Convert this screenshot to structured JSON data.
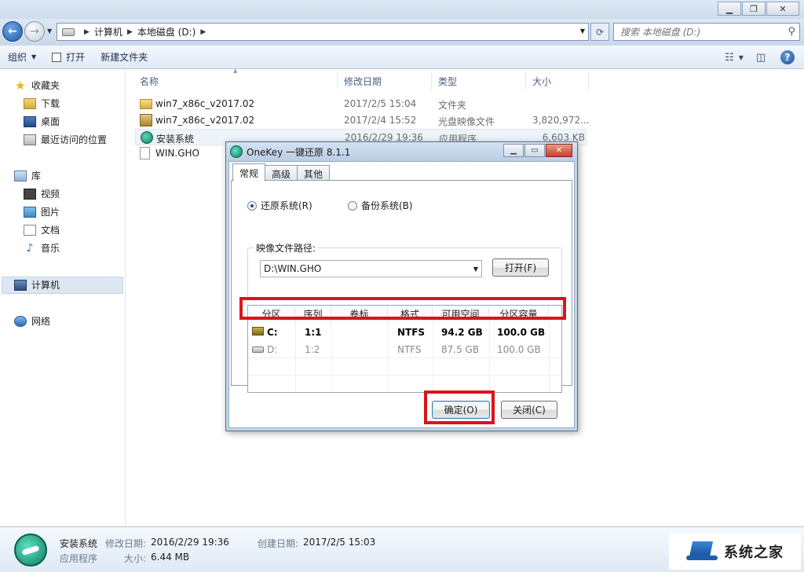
{
  "window": {
    "minimize": "▁",
    "maximize": "❐",
    "close": "✕"
  },
  "address": {
    "crumbs": [
      "计算机",
      "本地磁盘 (D:)"
    ],
    "search_placeholder": "搜索 本地磁盘 (D:)"
  },
  "toolbar": {
    "organize": "组织",
    "open": "打开",
    "new_folder": "新建文件夹"
  },
  "nav": {
    "favorites": "收藏夹",
    "downloads": "下载",
    "desktop": "桌面",
    "recent": "最近访问的位置",
    "libraries": "库",
    "videos": "视频",
    "pictures": "图片",
    "documents": "文档",
    "music": "音乐",
    "computer": "计算机",
    "network": "网络"
  },
  "columns": {
    "name": "名称",
    "modified": "修改日期",
    "type": "类型",
    "size": "大小"
  },
  "files": [
    {
      "name": "win7_x86c_v2017.02",
      "date": "2017/2/5 15:04",
      "type": "文件夹",
      "size": "",
      "icon": "folder-icon"
    },
    {
      "name": "win7_x86c_v2017.02",
      "date": "2017/2/4 15:52",
      "type": "光盘映像文件",
      "size": "3,820,972...",
      "icon": "disc-image-icon"
    },
    {
      "name": "安装系统",
      "date": "2016/2/29 19:36",
      "type": "应用程序",
      "size": "6,603 KB",
      "icon": "app-icon"
    },
    {
      "name": "WIN.GHO",
      "date": "",
      "type": "",
      "size": "",
      "icon": "file-icon"
    }
  ],
  "details": {
    "name": "安装系统",
    "modified_label": "修改日期:",
    "modified_value": "2016/2/29 19:36",
    "created_label": "创建日期:",
    "created_value": "2017/2/5 15:03",
    "type": "应用程序",
    "size_label": "大小:",
    "size_value": "6.44 MB"
  },
  "watermark": "系统之家",
  "dialog": {
    "title": "OneKey 一键还原 8.1.1",
    "tabs": [
      "常规",
      "高级",
      "其他"
    ],
    "radio_restore": "还原系统(R)",
    "radio_backup": "备份系统(B)",
    "image_path_label": "映像文件路径:",
    "image_path_value": "D:\\WIN.GHO",
    "open_button": "打开(F)",
    "table_headers": [
      "分区",
      "序列",
      "卷标",
      "格式",
      "可用空间",
      "分区容量"
    ],
    "partitions": [
      {
        "drive": "C:",
        "seq": "1:1",
        "label": "",
        "format": "NTFS",
        "free": "94.2 GB",
        "capacity": "100.0 GB"
      },
      {
        "drive": "D:",
        "seq": "1:2",
        "label": "",
        "format": "NTFS",
        "free": "87.5 GB",
        "capacity": "100.0 GB"
      }
    ],
    "ok_button": "确定(O)",
    "close_button": "关闭(C)"
  },
  "colors": {
    "highlight_red": "#d9151b",
    "accent_blue": "#1f5ea8"
  }
}
